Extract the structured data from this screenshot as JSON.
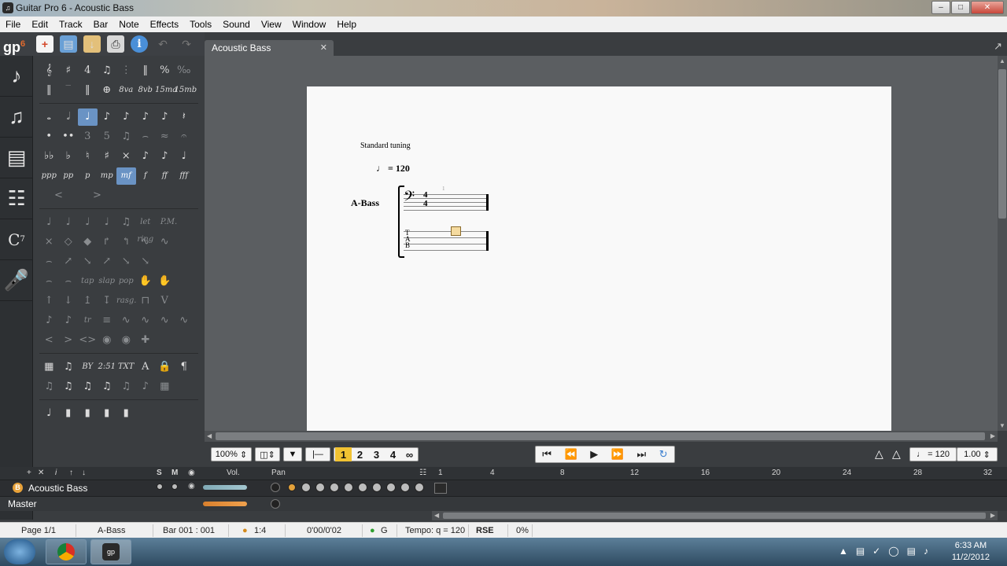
{
  "window": {
    "title": "Guitar Pro 6 - Acoustic Bass",
    "buttons": [
      "‒",
      "□",
      "✕"
    ]
  },
  "menu": [
    "File",
    "Edit",
    "Track",
    "Bar",
    "Note",
    "Effects",
    "Tools",
    "Sound",
    "View",
    "Window",
    "Help"
  ],
  "toolbar": {
    "logo": "gp",
    "logo_version": "6",
    "info_label": "i"
  },
  "document": {
    "tab_title": "Acoustic Bass",
    "tab_close": "✕",
    "tuning": "Standard tuning",
    "tempo": "♩ = 120",
    "track_short": "A-Bass",
    "bar_number": "1",
    "time_sig_top": "4",
    "time_sig_bottom": "4",
    "tab_letters": [
      "T",
      "A",
      "B"
    ]
  },
  "palette": {
    "row_dynamics": [
      "ppp",
      "pp",
      "p",
      "mp",
      "mf",
      "f",
      "ff",
      "fff"
    ],
    "row_octave": [
      "8va",
      "8vb",
      "15ma",
      "15mb"
    ],
    "row_techniques_text": [
      "tap",
      "slap",
      "pop"
    ],
    "row_misc_text": [
      "let ring",
      "P.M.",
      "rasg.",
      "tr"
    ],
    "row_text_tools": [
      "BY",
      "2:51",
      "TXT",
      "A"
    ]
  },
  "controls": {
    "zoom": "100%",
    "voices": [
      "1",
      "2",
      "3",
      "4"
    ],
    "tempo_value": "♩ = 120",
    "speed": "1.00"
  },
  "tracks_header": {
    "solo": "S",
    "mute": "M",
    "vol": "Vol.",
    "pan": "Pan",
    "timeline": [
      "1",
      "4",
      "8",
      "12",
      "16",
      "20",
      "24",
      "28",
      "32"
    ]
  },
  "tracks": [
    {
      "name": "Acoustic Bass",
      "badge": "B",
      "volume": 0.75
    }
  ],
  "master": {
    "name": "Master",
    "volume": 0.75
  },
  "status": {
    "page": "Page 1/1",
    "track": "A-Bass",
    "bar": "Bar 001 : 001",
    "time_sig": "1:4",
    "time": "0'00/0'02",
    "key": "G",
    "tempo": "Tempo: q = 120",
    "engine": "RSE",
    "percent": "0%"
  },
  "taskbar": {
    "time": "6:33 AM",
    "date": "11/2/2012"
  },
  "colors": {
    "accent": "#f1c232",
    "selected": "#6a93c4",
    "panel": "#3a3d40"
  }
}
